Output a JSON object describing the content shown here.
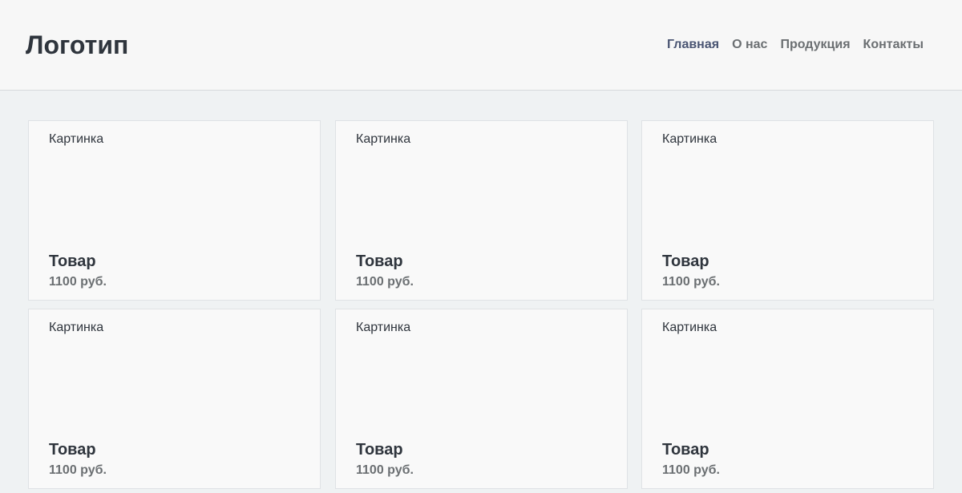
{
  "header": {
    "logo": "Логотип",
    "nav": [
      {
        "label": "Главная",
        "active": true
      },
      {
        "label": "О нас",
        "active": false
      },
      {
        "label": "Продукция",
        "active": false
      },
      {
        "label": "Контакты",
        "active": false
      }
    ]
  },
  "products": [
    {
      "image_label": "Картинка",
      "title": "Товар",
      "price": "1100 руб."
    },
    {
      "image_label": "Картинка",
      "title": "Товар",
      "price": "1100 руб."
    },
    {
      "image_label": "Картинка",
      "title": "Товар",
      "price": "1100 руб."
    },
    {
      "image_label": "Картинка",
      "title": "Товар",
      "price": "1100 руб."
    },
    {
      "image_label": "Картинка",
      "title": "Товар",
      "price": "1100 руб."
    },
    {
      "image_label": "Картинка",
      "title": "Товар",
      "price": "1100 руб."
    }
  ],
  "colors": {
    "nav_active": "#4a5573",
    "nav_inactive": "#6b6f72",
    "text": "#2f353d",
    "page_bg": "#eff2f3"
  }
}
